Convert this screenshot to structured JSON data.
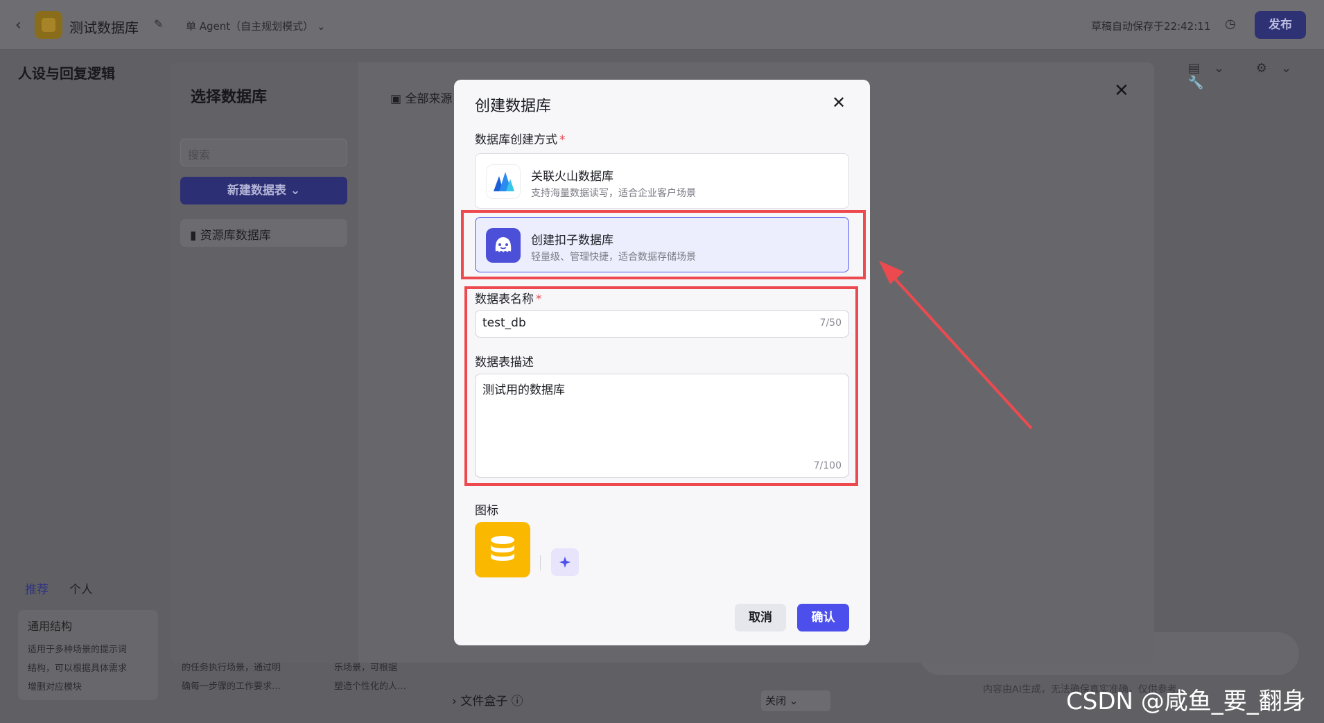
{
  "topbar": {
    "title": "测试数据库",
    "agent_mode": "单 Agent（自主规划模式）",
    "autosave": "草稿自动保存于22:42:11",
    "publish": "发布"
  },
  "background": {
    "left_panel_title": "人设与回复逻辑",
    "tab_recommended": "推荐",
    "tab_personal": "个人",
    "card_title": "通用结构",
    "card_desc_lines": [
      "适用于多种场景的提示词",
      "结构，可以根据具体需求",
      "增删对应模块"
    ],
    "card2_lines": [
      "的任务执行场景，通过明",
      "确每一步骤的工作要求…"
    ],
    "card3_lines": [
      "乐场景，可根据",
      "塑造个性化的人…"
    ],
    "file_box": "文件盒子",
    "file_box_state": "关闭",
    "ai_note": "内容由AI生成，无法确保真实准确，仅供参考。"
  },
  "select_modal": {
    "title": "选择数据库",
    "search_placeholder": "搜索",
    "new_table": "新建数据表",
    "resource_db": "资源库数据库",
    "all_sources": "全部来源"
  },
  "dialog": {
    "title": "创建数据库",
    "method_label": "数据库创建方式",
    "options": [
      {
        "name": "关联火山数据库",
        "desc": "支持海量数据读写，适合企业客户场景",
        "selected": false
      },
      {
        "name": "创建扣子数据库",
        "desc": "轻量级、管理快捷，适合数据存储场景",
        "selected": true
      }
    ],
    "name_label": "数据表名称",
    "name_value": "test_db",
    "name_counter": "7/50",
    "desc_label": "数据表描述",
    "desc_value": "测试用的数据库",
    "desc_counter": "7/100",
    "icon_label": "图标",
    "cancel": "取消",
    "confirm": "确认"
  },
  "watermark": "CSDN @咸鱼_要_翻身",
  "colors": {
    "accent": "#4c4fec",
    "highlight": "#ec4a4f",
    "icon_bg": "#fbb800"
  }
}
